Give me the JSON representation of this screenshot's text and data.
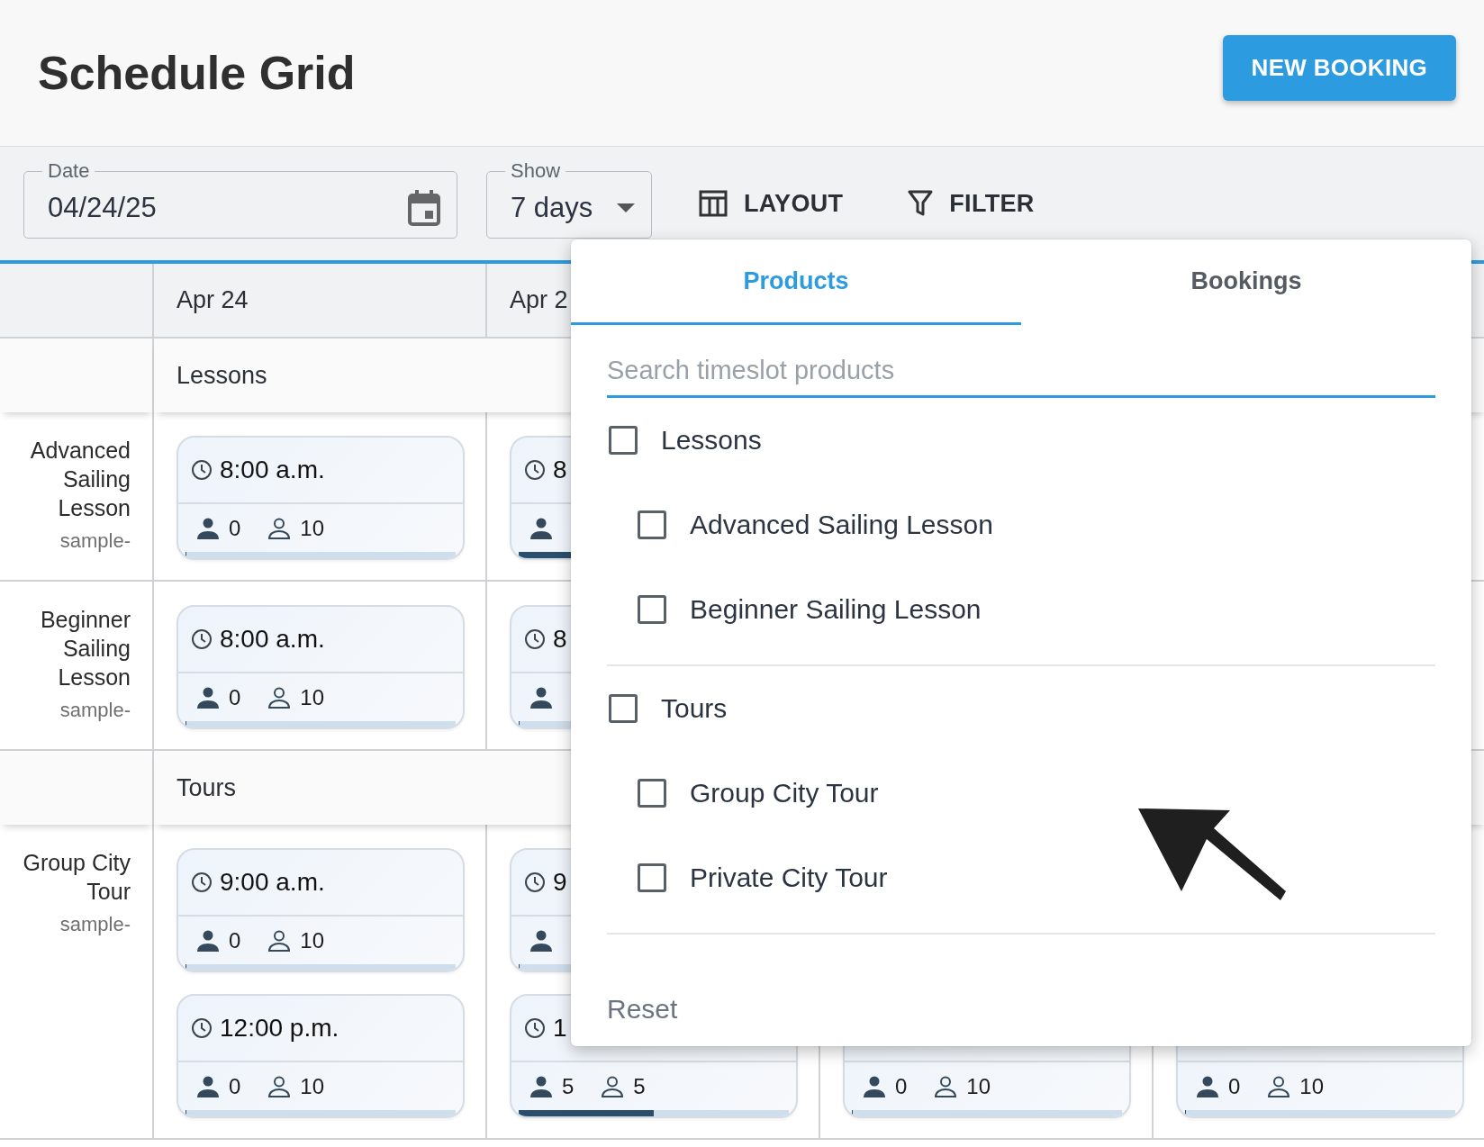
{
  "header": {
    "title": "Schedule Grid",
    "new_booking_button": "NEW BOOKING"
  },
  "toolbar": {
    "date_field": {
      "label": "Date",
      "value": "04/24/25"
    },
    "show_field": {
      "label": "Show",
      "value": "7 days"
    },
    "layout_button": "LAYOUT",
    "filter_button": "FILTER"
  },
  "grid": {
    "columns": [
      "Apr 24",
      "Apr 2"
    ],
    "sections": [
      {
        "name": "Lessons",
        "products": [
          {
            "name": "Advanced Sailing Lesson",
            "code": "sample-",
            "cells": [
              [
                {
                  "time": "8:00 a.m.",
                  "booked": "0",
                  "available": "10",
                  "level": 0
                }
              ],
              [
                {
                  "time": "8",
                  "level": 0.3
                }
              ]
            ]
          },
          {
            "name": "Beginner Sailing Lesson",
            "code": "sample-",
            "cells": [
              [
                {
                  "time": "8:00 a.m.",
                  "booked": "0",
                  "available": "10",
                  "level": 0
                }
              ],
              [
                {
                  "time": "8",
                  "level": 0
                }
              ]
            ]
          }
        ]
      },
      {
        "name": "Tours",
        "products": [
          {
            "name": "Group City Tour",
            "code": "sample-",
            "cells": [
              [
                {
                  "time": "9:00 a.m.",
                  "booked": "0",
                  "available": "10",
                  "level": 0
                },
                {
                  "time": "12:00 p.m.",
                  "booked": "0",
                  "available": "10",
                  "level": 0
                }
              ],
              [
                {
                  "time": "9",
                  "level": 0
                },
                {
                  "time": "1",
                  "booked": "5",
                  "available": "5",
                  "level": 0.5
                }
              ],
              [
                {
                  "booked": "0",
                  "available": "10",
                  "level": 0
                }
              ],
              [
                {
                  "booked": "0",
                  "available": "10",
                  "level": 0
                }
              ]
            ]
          }
        ]
      }
    ]
  },
  "filter_popup": {
    "tabs": [
      {
        "label": "Products",
        "selected": true
      },
      {
        "label": "Bookings",
        "selected": false
      }
    ],
    "search": {
      "placeholder": "Search timeslot products"
    },
    "groups": [
      {
        "label": "Lessons",
        "checked": false,
        "children": [
          {
            "label": "Advanced Sailing Lesson",
            "checked": false
          },
          {
            "label": "Beginner Sailing Lesson",
            "checked": false
          }
        ]
      },
      {
        "label": "Tours",
        "checked": false,
        "children": [
          {
            "label": "Group City Tour",
            "checked": false
          },
          {
            "label": "Private City Tour",
            "checked": false
          }
        ]
      }
    ],
    "reset_button": "Reset"
  }
}
